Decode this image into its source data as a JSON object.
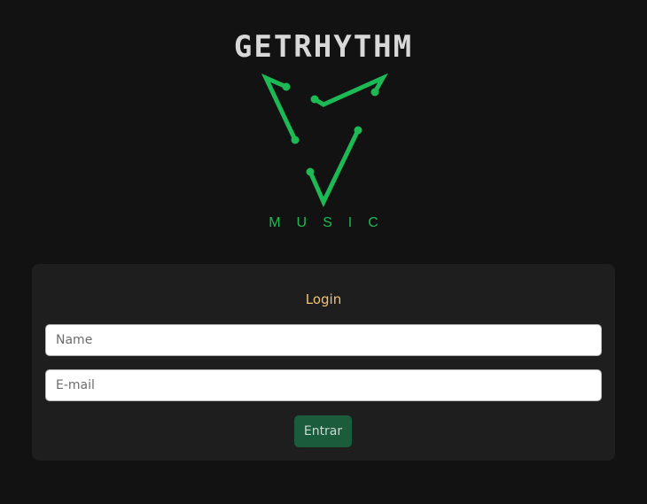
{
  "brand": {
    "wordmark": "GETRHYTHM",
    "submark": "MUSIC",
    "accent_color": "#1db954"
  },
  "login": {
    "title": "Login",
    "name_placeholder": "Name",
    "email_placeholder": "E-mail",
    "submit_label": "Entrar",
    "title_color": "#f0c27a",
    "button_color": "#1a5c3c"
  }
}
